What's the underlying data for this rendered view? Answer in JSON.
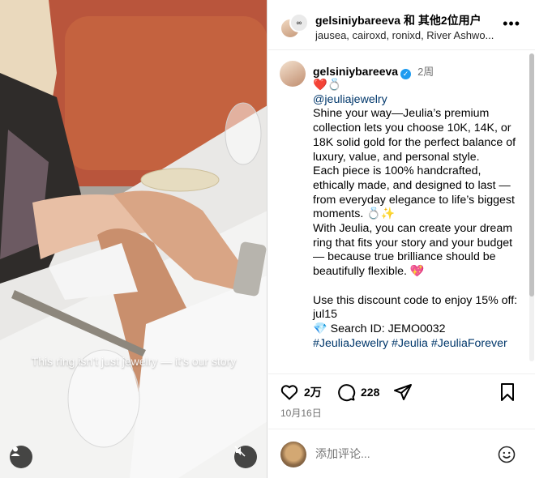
{
  "media": {
    "overlay_text": "This ring isn’t just jewelry — it’s our story"
  },
  "header": {
    "title": "gelsiniybareeva 和 其他2位用户",
    "subtitle": "jausea, cairoxd, ronixd, River Ashwo...",
    "more_label": "•••"
  },
  "caption": {
    "username": "gelsiniybareeva",
    "time": "2周",
    "emoji_line": "❤️💍",
    "mention": "@jeuliajewelry",
    "para1": "Shine your way—Jeulia’s premium collection lets you choose 10K, 14K, or 18K solid gold for the perfect balance of luxury, value, and personal style.",
    "para2": "Each piece is 100% handcrafted, ethically made, and designed to last — from everyday elegance to life’s biggest moments. 💍✨",
    "para3": "With Jeulia, you can create your dream ring that fits your story and your budget — because true brilliance should be beautifully flexible. 💖",
    "para4": "Use this discount code to enjoy 15% off: jul15",
    "search_id": "💎 Search ID: JEMO0032",
    "hashtags": "#JeuliaJewelry #Jeulia #JeuliaForever"
  },
  "actions": {
    "likes": "2万",
    "comments": "228"
  },
  "date": "10月16日",
  "comment": {
    "placeholder": "添加评论..."
  },
  "colors": {
    "link": "#00376b",
    "verified": "#1d9bf0",
    "muted": "#737373"
  }
}
